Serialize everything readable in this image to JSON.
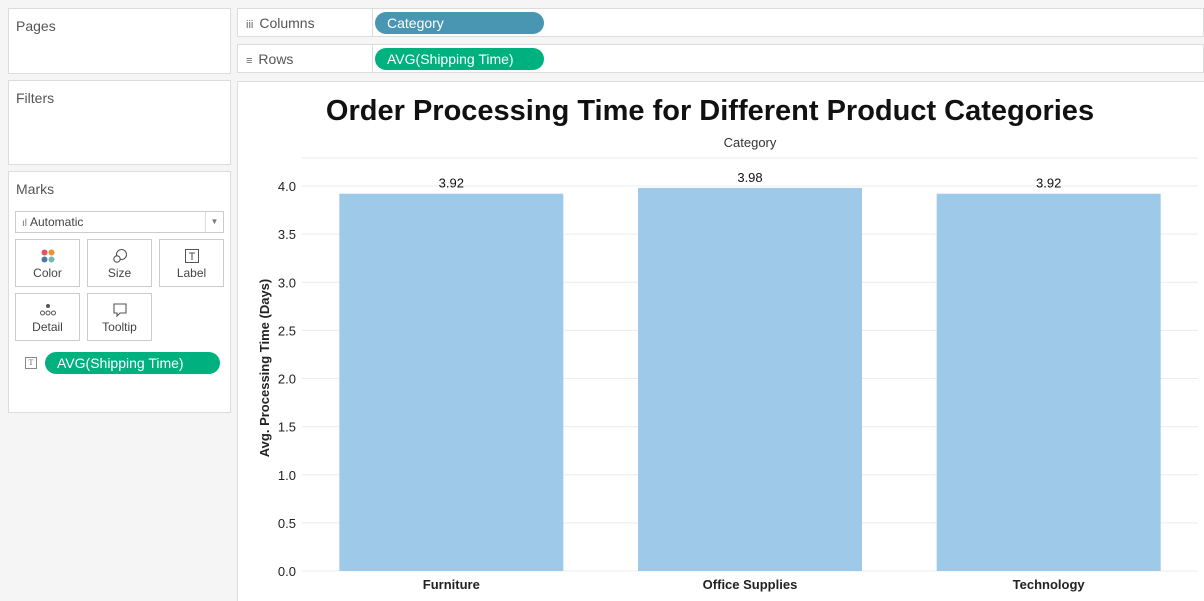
{
  "panels": {
    "pages_label": "Pages",
    "filters_label": "Filters",
    "marks_label": "Marks"
  },
  "marks": {
    "type": "Automatic",
    "buttons": [
      {
        "label": "Color",
        "icon": "color-dots-icon"
      },
      {
        "label": "Size",
        "icon": "size-icon"
      },
      {
        "label": "Label",
        "icon": "label-icon"
      },
      {
        "label": "Detail",
        "icon": "detail-icon"
      },
      {
        "label": "Tooltip",
        "icon": "tooltip-icon"
      }
    ],
    "field_pill": "AVG(Shipping Time)"
  },
  "shelves": {
    "columns_label": "Columns",
    "columns_pill": "Category",
    "rows_label": "Rows",
    "rows_pill": "AVG(Shipping Time)"
  },
  "colors": {
    "bar": "#9fc9e8",
    "green_pill": "#00b180",
    "blue_pill": "#4996b2"
  },
  "chart_data": {
    "type": "bar",
    "title": "Order Processing Time for Different Product Categories",
    "column_header": "Category",
    "categories": [
      "Furniture",
      "Office Supplies",
      "Technology"
    ],
    "values": [
      3.92,
      3.98,
      3.92
    ],
    "value_labels": [
      "3.92",
      "3.98",
      "3.92"
    ],
    "ylabel": "Avg. Processing Time (Days)",
    "yticks": [
      "0.0",
      "0.5",
      "1.0",
      "1.5",
      "2.0",
      "2.5",
      "3.0",
      "3.5",
      "4.0"
    ],
    "ylim": [
      0,
      4.0
    ],
    "grid": true
  }
}
